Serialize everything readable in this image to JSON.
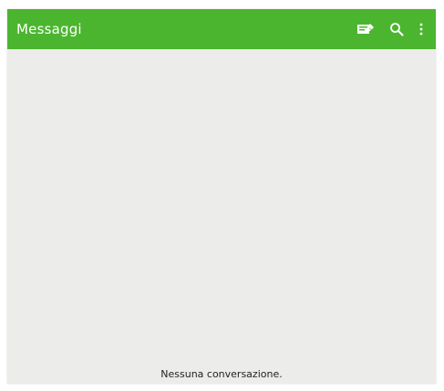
{
  "appbar": {
    "title": "Messaggi",
    "background": "#4cb52f",
    "actions": [
      {
        "icon": "compose-message-icon"
      },
      {
        "icon": "search-icon"
      },
      {
        "icon": "overflow-menu-icon"
      }
    ]
  },
  "conversations": {
    "empty_text": "Nessuna conversazione."
  }
}
